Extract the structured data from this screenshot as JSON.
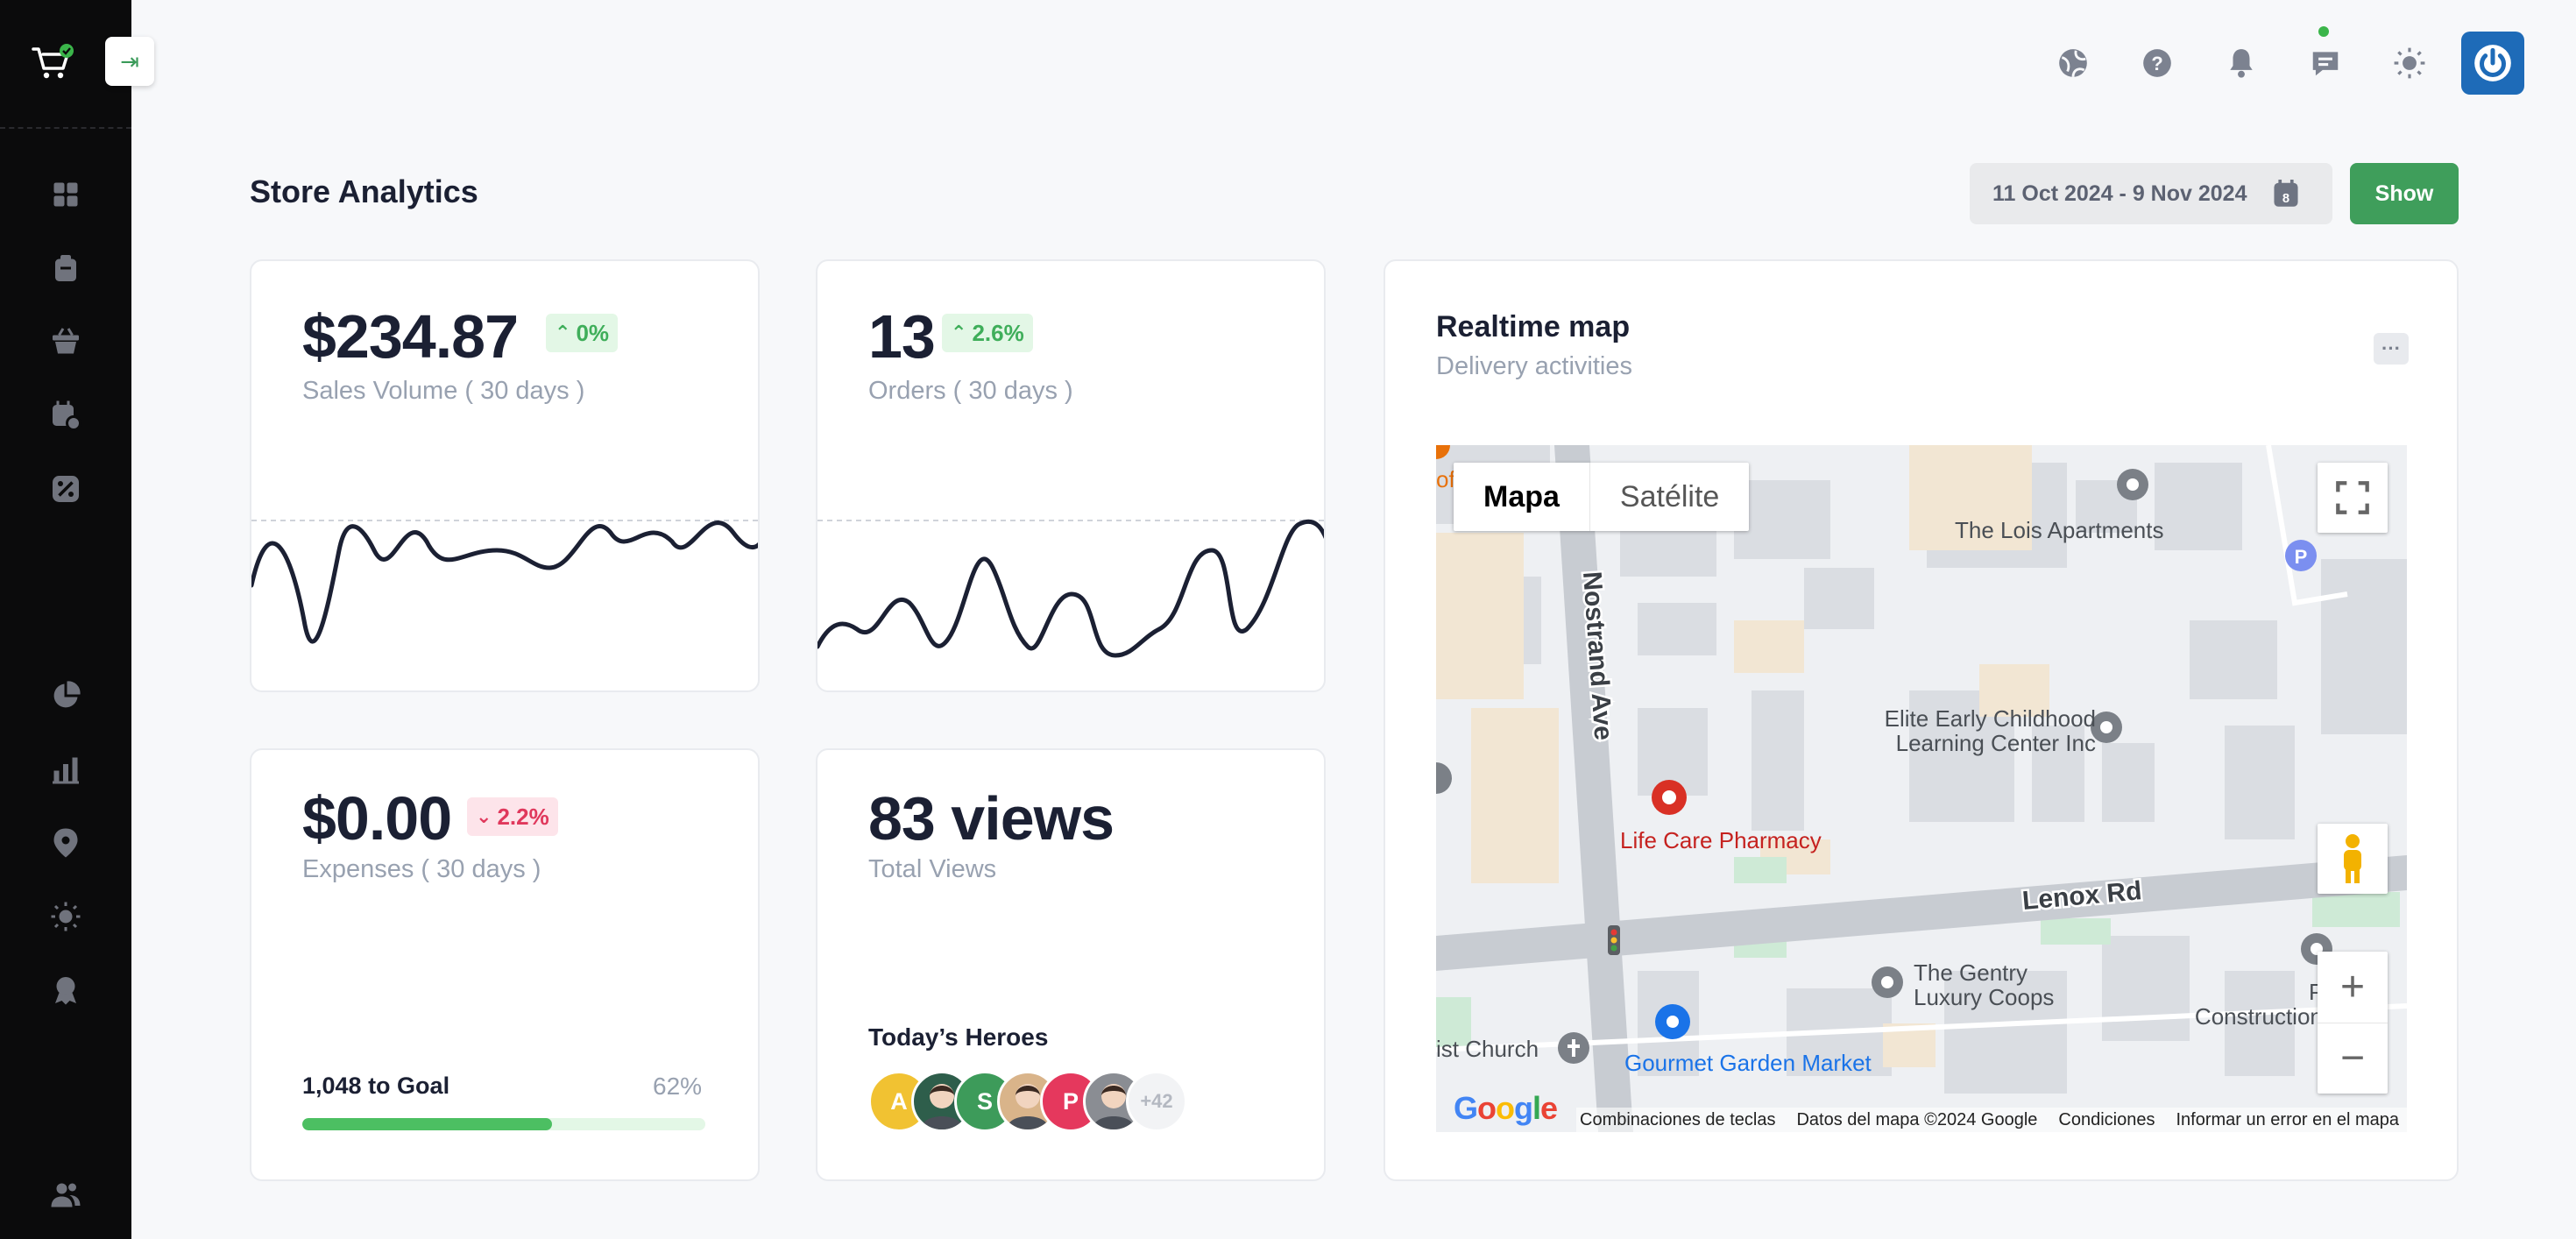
{
  "sidebar": {
    "icons": [
      "grid-icon",
      "clipboard-icon",
      "basket-icon",
      "calendar-gear-icon",
      "discount-icon",
      "pie-chart-icon",
      "bar-chart-icon",
      "map-pin-icon",
      "sun-icon",
      "award-icon",
      "users-icon"
    ]
  },
  "header": {
    "icons": [
      "analytics-globe-icon",
      "help-icon",
      "bell-icon",
      "chat-icon",
      "theme-sun-icon"
    ],
    "accent": "#3bb54a"
  },
  "page": {
    "title": "Store Analytics",
    "date_range": "11 Oct 2024 - 9 Nov 2024",
    "calendar_day": "8",
    "show_label": "Show"
  },
  "cards": {
    "sales": {
      "value": "$234.87",
      "change": "0%",
      "label": "Sales Volume ( 30 days )"
    },
    "orders": {
      "value": "13",
      "change": "2.6%",
      "label": "Orders ( 30 days )"
    },
    "expenses": {
      "value": "$0.00",
      "change": "2.2%",
      "label": "Expenses ( 30 days )",
      "goal_label": "1,048 to Goal",
      "goal_pct": "62%",
      "goal_fraction": 0.62
    },
    "views": {
      "value": "83 views",
      "label": "Total Views",
      "heroes_title": "Today’s Heroes",
      "heroes": [
        {
          "initial": "A",
          "color": "#f1c232"
        },
        {
          "initial": "",
          "color": "#2e5e4b"
        },
        {
          "initial": "S",
          "color": "#3d9b5a"
        },
        {
          "initial": "",
          "color": "#d9b48a"
        },
        {
          "initial": "P",
          "color": "#e5385d"
        },
        {
          "initial": "",
          "color": "#8a8d93"
        }
      ],
      "more": "+42"
    }
  },
  "map": {
    "title": "Realtime map",
    "subtitle": "Delivery activities",
    "dots": "···",
    "type_map": "Mapa",
    "type_satellite": "Satélite",
    "google": "Google",
    "footer": [
      "Combinaciones de teclas",
      "Datos del mapa ©2024 Google",
      "Condiciones",
      "Informar un error en el mapa"
    ],
    "street_nostrand": "Nostrand Ave",
    "street_lenox": "Lenox Rd",
    "poi_lois": "The Lois Apartments",
    "poi_elite_1": "Elite Early Childhood",
    "poi_elite_2": "Learning Center Inc",
    "poi_pharmacy": "Life Care Pharmacy",
    "poi_gentry_1": "The Gentry",
    "poi_gentry_2": "Luxury Coops",
    "poi_pinn_1": "Pinn",
    "poi_pinn_2": "Construction Gr",
    "poi_church": "ist Church",
    "poi_market": "Gourmet Garden Market",
    "poi_of": "of",
    "parking": "P"
  }
}
